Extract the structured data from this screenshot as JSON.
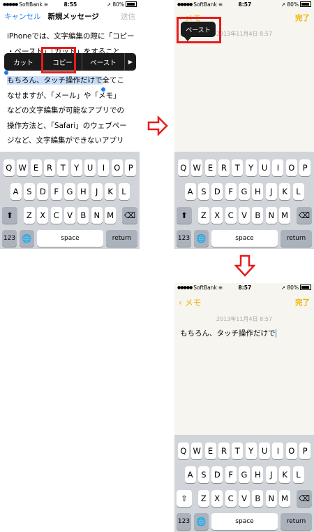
{
  "status": {
    "carrier": "SoftBank",
    "battery": "80%"
  },
  "panel1": {
    "time": "8:55",
    "cancel": "キャンセル",
    "title": "新規メッセージ",
    "send": "送信",
    "text_line1": "iPhoneでは、文字編集の際に「コピー",
    "text_line2": "・ペースト」「カット」をすること",
    "selected": "もちろん、タッチ操作だけで",
    "text_line3_rest": "全てこ",
    "text_line4": "なせますが、「メール」や「メモ」",
    "text_line5": "などの文字編集が可能なアプリでの",
    "text_line6": "操作方法と、「Safari」のウェブペー",
    "text_line7": "ジなど、文字編集ができないアプリ",
    "text_line8": "での操作方法は若干異なります。",
    "menu": {
      "cut": "カット",
      "copy": "コピー",
      "paste": "ペースト",
      "more": "▶"
    }
  },
  "panel2": {
    "time": "8:57",
    "back": "メモ",
    "done": "完了",
    "date": "2013年11月4日 8:57",
    "paste": "ペースト"
  },
  "panel3": {
    "time": "8:57",
    "back": "メモ",
    "done": "完了",
    "date": "2013年11月4日 8:57",
    "note": "もちろん、タッチ操作だけで"
  },
  "keyboard": {
    "row1": [
      "Q",
      "W",
      "E",
      "R",
      "T",
      "Y",
      "U",
      "I",
      "O",
      "P"
    ],
    "row2": [
      "A",
      "S",
      "D",
      "F",
      "G",
      "H",
      "J",
      "K",
      "L"
    ],
    "row3": [
      "Z",
      "X",
      "C",
      "V",
      "B",
      "N",
      "M"
    ],
    "num": "123",
    "space": "space",
    "return": "return"
  },
  "colors": {
    "accent_red": "#e81b1b",
    "link_blue": "#1a7cf5",
    "yellow": "#f0b400",
    "selection": "#c7dcf6"
  }
}
